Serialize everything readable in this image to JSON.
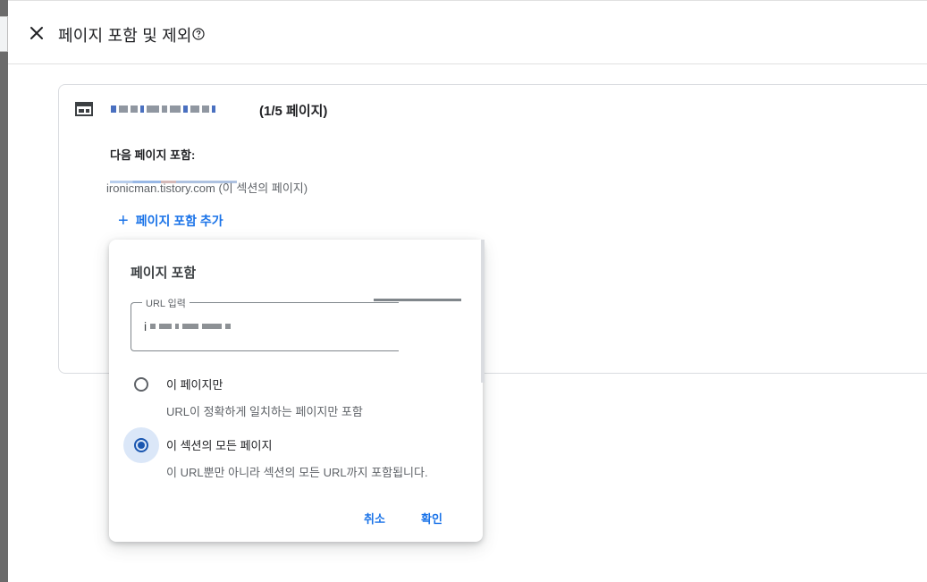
{
  "header": {
    "title": "페이지 포함 및 제외",
    "close_icon": "close-icon",
    "help_icon": "help-circle-icon"
  },
  "card": {
    "icon": "layout-icon",
    "page_count": "(1/5 페이지)",
    "include_label": "다음 페이지 포함:",
    "url_host": "ironicman.tistory.com",
    "url_suffix": "(이 섹션의 페이지)",
    "add_link": "페이지 포함 추가"
  },
  "dialog": {
    "title": "페이지 포함",
    "url_field_label": "URL 입력",
    "url_field_value_prefix": "i",
    "options": [
      {
        "label": "이 페이지만",
        "description": "URL이 정확하게 일치하는 페이지만 포함",
        "selected": false
      },
      {
        "label": "이 섹션의 모든 페이지",
        "description": "이 URL뿐만 아니라 섹션의 모든 URL까지 포함됩니다.",
        "selected": true
      }
    ],
    "cancel_label": "취소",
    "confirm_label": "확인"
  },
  "colors": {
    "accent": "#1a73e8",
    "radio_selected": "#1a56b0",
    "border": "#dadce0"
  }
}
